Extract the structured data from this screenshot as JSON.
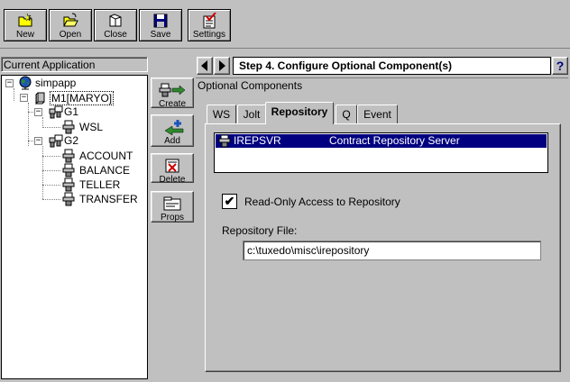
{
  "toolbar": {
    "new_label": "New",
    "open_label": "Open",
    "close_label": "Close",
    "save_label": "Save",
    "settings_label": "Settings"
  },
  "left_panel": {
    "title": "Current Application",
    "tree": {
      "root": "simpapp",
      "machine": "M1[MARYO]",
      "groups": [
        {
          "name": "G1",
          "servers": [
            "WSL"
          ]
        },
        {
          "name": "G2",
          "servers": [
            "ACCOUNT",
            "BALANCE",
            "TELLER",
            "TRANSFER"
          ]
        }
      ]
    }
  },
  "actions": {
    "create_label": "Create",
    "add_label": "Add",
    "delete_label": "Delete",
    "props_label": "Props"
  },
  "step": {
    "title": "Step 4. Configure Optional Component(s)",
    "help": "?"
  },
  "section_header": "Optional Components",
  "tabs": [
    {
      "label": "WS"
    },
    {
      "label": "Jolt"
    },
    {
      "label": "Repository",
      "active": true
    },
    {
      "label": "Q"
    },
    {
      "label": "Event"
    }
  ],
  "server_list": {
    "selected_name": "IREPSVR",
    "selected_desc": "Contract Repository Server"
  },
  "readonly": {
    "label": "Read-Only Access to Repository",
    "checked": true
  },
  "repository_file": {
    "label": "Repository File:",
    "value": "c:\\tuxedo\\misc\\irepository"
  },
  "colors": {
    "selection": "#000080",
    "window": "#c0c0c0",
    "globe_blue": "#1d53b8",
    "arrow_green": "#2e8b2e"
  }
}
